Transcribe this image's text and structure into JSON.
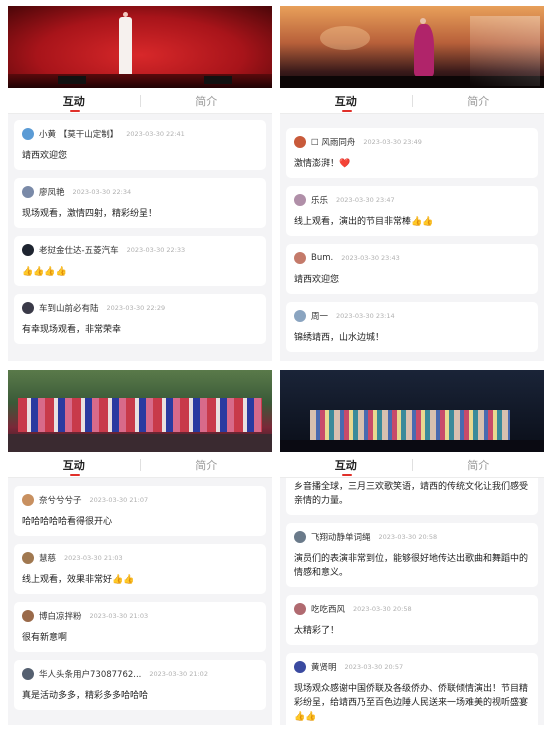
{
  "tabs": {
    "interact": "互动",
    "intro": "简介"
  },
  "panels": [
    {
      "comments": [
        {
          "user": "小黄 【莫干山定制】",
          "time": "2023-03-30 22:41",
          "text": "靖西欢迎您",
          "avatar_color": "#5b9bd5"
        },
        {
          "user": "廖凤艳",
          "time": "2023-03-30 22:34",
          "text": "现场观看，激情四射，精彩纷呈！",
          "avatar_color": "#7a8aa8"
        },
        {
          "user": "老挝金仕达-五菱汽车",
          "time": "2023-03-30 22:33",
          "text": "👍👍👍👍",
          "avatar_color": "#1e2430"
        },
        {
          "user": "车到山前必有陆",
          "time": "2023-03-30 22:29",
          "text": "有幸现场观看，非常荣幸",
          "avatar_color": "#3a3a48"
        }
      ]
    },
    {
      "comments": [
        {
          "user": "☐ 风雨同舟",
          "time": "2023-03-30 23:49",
          "text": "激情澎湃！❤️",
          "avatar_color": "#c85a3a"
        },
        {
          "user": "乐乐",
          "time": "2023-03-30 23:47",
          "text": "线上观看，演出的节目非常棒👍👍",
          "avatar_color": "#b08fa8"
        },
        {
          "user": "Bum.",
          "time": "2023-03-30 23:43",
          "text": "靖西欢迎您",
          "avatar_color": "#c47a6a"
        },
        {
          "user": "周一",
          "time": "2023-03-30 23:14",
          "text": "锦绣靖西，山水边城！",
          "avatar_color": "#8aa4c0"
        }
      ]
    },
    {
      "comments": [
        {
          "user": "奈兮兮兮子",
          "time": "2023-03-30 21:07",
          "text": "哈哈哈哈哈看得很开心",
          "avatar_color": "#c89060"
        },
        {
          "user": "慧慈",
          "time": "2023-03-30 21:03",
          "text": "线上观看，效果非常好👍👍",
          "avatar_color": "#a07850"
        },
        {
          "user": "博白凉拌粉",
          "time": "2023-03-30 21:03",
          "text": "很有新意啊",
          "avatar_color": "#9a6a4a"
        },
        {
          "user": "华人头条用户73087762...",
          "time": "2023-03-30 21:02",
          "text": "真是活动多多，精彩多多哈哈哈",
          "avatar_color": "#556070"
        }
      ]
    },
    {
      "partial_text": "乡音播全球，三月三欢歌笑语，靖西的传统文化让我们感受亲情的力量。",
      "comments": [
        {
          "user": "飞翔动静单词绳",
          "time": "2023-03-30 20:58",
          "text": "演员们的表演非常到位，能够很好地传达出歌曲和舞蹈中的情感和意义。",
          "avatar_color": "#6a7a8a"
        },
        {
          "user": "吃吃西风",
          "time": "2023-03-30 20:58",
          "text": "太精彩了！",
          "avatar_color": "#b06a70"
        },
        {
          "user": "黄贤明",
          "time": "2023-03-30 20:57",
          "text": "现场观众感谢中国侨联及各级侨办、侨联倾情演出！节目精彩纷呈，给靖西乃至百色边陲人民送来一场难美的视听盛宴👍👍",
          "avatar_color": "#3a4aa0"
        }
      ]
    }
  ]
}
